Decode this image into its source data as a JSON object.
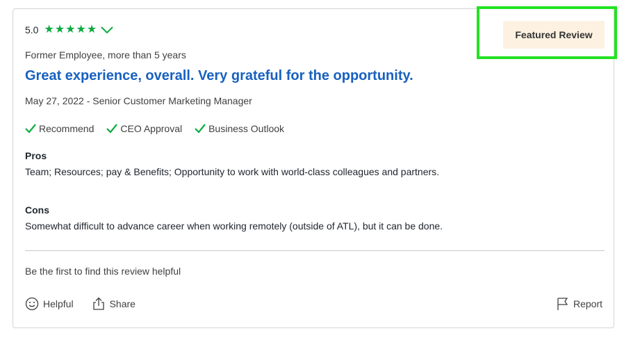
{
  "review": {
    "rating": "5.0",
    "stars": [
      "star-icon",
      "star-icon",
      "star-icon",
      "star-icon",
      "star-icon"
    ],
    "badge": "Featured Review",
    "employment": "Former Employee, more than 5 years",
    "title": "Great experience, overall. Very grateful for the opportunity.",
    "meta": "May 27, 2022 - Senior Customer Marketing Manager",
    "checks": [
      "Recommend",
      "CEO Approval",
      "Business Outlook"
    ],
    "pros_label": "Pros",
    "pros_text": "Team; Resources; pay & Benefits; Opportunity to work with world-class colleagues and partners.",
    "cons_label": "Cons",
    "cons_text": "Somewhat difficult to advance career when working remotely (outside of ATL), but it can be done.",
    "helpful_note": "Be the first to find this review helpful",
    "actions": {
      "helpful": "Helpful",
      "share": "Share",
      "report": "Report"
    }
  },
  "colors": {
    "accent_green": "#0caa41",
    "title_blue": "#1861bf",
    "badge_bg": "#fdf2e1",
    "highlight": "#22e322"
  }
}
